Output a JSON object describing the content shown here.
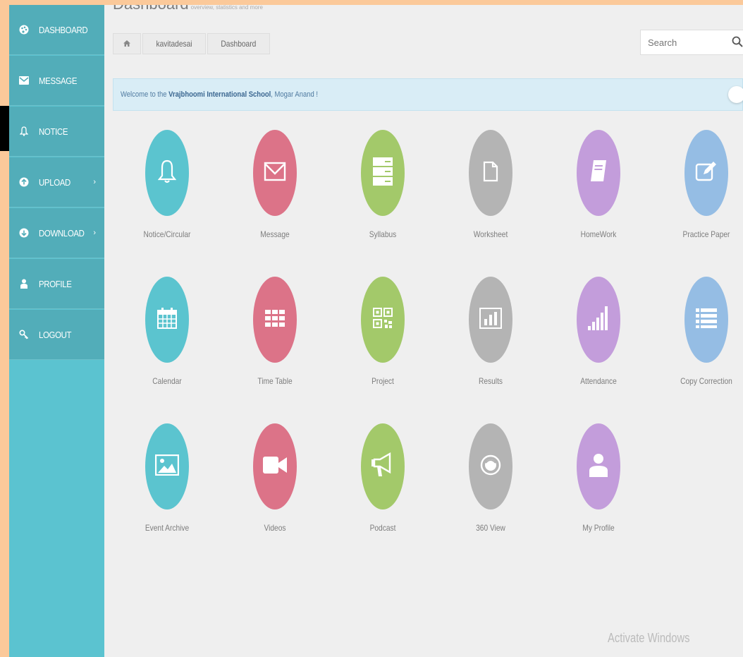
{
  "page": {
    "title": "Dashboard",
    "subtitle": "overview, statistics and more"
  },
  "colors": {
    "sidebar": "#5bc3d0",
    "sidebar_item": "#52adb9",
    "teal": "#5bc4cf",
    "pink": "#dc7388",
    "green": "#a3c96a",
    "gray": "#b4b4b4",
    "purple": "#c39ddb",
    "blue": "#95bde4"
  },
  "sidebar": {
    "items": [
      {
        "label": "DASHBOARD",
        "icon": "palette-icon"
      },
      {
        "label": "MESSAGE",
        "icon": "envelope-icon"
      },
      {
        "label": "NOTICE",
        "icon": "bell-icon"
      },
      {
        "label": "UPLOAD",
        "icon": "upload-circle-icon",
        "caret": "›"
      },
      {
        "label": "DOWNLOAD",
        "icon": "download-circle-icon",
        "caret": "›"
      },
      {
        "label": "PROFILE",
        "icon": "user-icon"
      },
      {
        "label": "LOGOUT",
        "icon": "key-icon"
      }
    ]
  },
  "breadcrumb": [
    "kavitadesai",
    "Dashboard"
  ],
  "search": {
    "placeholder": "Search"
  },
  "welcome": {
    "prefix": "Welcome to the ",
    "school": "Vrajbhoomi International School",
    "suffix": ", Mogar Anand !"
  },
  "tiles": [
    {
      "label": "Notice/Circular",
      "icon": "bell-icon",
      "color": "teal"
    },
    {
      "label": "Message",
      "icon": "envelope-icon",
      "color": "pink"
    },
    {
      "label": "Syllabus",
      "icon": "server-icon",
      "color": "green"
    },
    {
      "label": "Worksheet",
      "icon": "file-icon",
      "color": "gray"
    },
    {
      "label": "HomeWork",
      "icon": "book-icon",
      "color": "purple"
    },
    {
      "label": "Practice Paper",
      "icon": "edit-icon",
      "color": "blue"
    },
    {
      "label": "Calendar",
      "icon": "calendar-icon",
      "color": "teal"
    },
    {
      "label": "Time Table",
      "icon": "grid-icon",
      "color": "pink"
    },
    {
      "label": "Project",
      "icon": "qrcode-icon",
      "color": "green"
    },
    {
      "label": "Results",
      "icon": "bar-chart-icon",
      "color": "gray"
    },
    {
      "label": "Attendance",
      "icon": "signal-icon",
      "color": "purple"
    },
    {
      "label": "Copy Correction",
      "icon": "list-icon",
      "color": "blue"
    },
    {
      "label": "Event Archive",
      "icon": "picture-icon",
      "color": "teal"
    },
    {
      "label": "Videos",
      "icon": "video-camera-icon",
      "color": "pink"
    },
    {
      "label": "Podcast",
      "icon": "megaphone-icon",
      "color": "green"
    },
    {
      "label": "360 View",
      "icon": "eye-icon",
      "color": "gray"
    },
    {
      "label": "My Profile",
      "icon": "user-icon",
      "color": "purple"
    }
  ],
  "watermark": "Activate Windows"
}
